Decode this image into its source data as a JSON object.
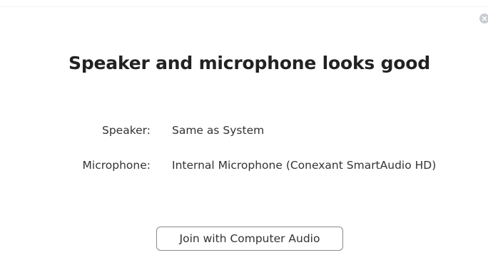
{
  "dialog": {
    "title": "Speaker and microphone looks good",
    "close_icon": "close-icon",
    "speaker": {
      "label": "Speaker:",
      "value": "Same as System"
    },
    "microphone": {
      "label": "Microphone:",
      "value": "Internal Microphone (Conexant SmartAudio HD)"
    },
    "join_button_label": "Join with Computer Audio"
  },
  "colors": {
    "title": "#222222",
    "text": "#333333",
    "close_button": "#c8ccd2",
    "button_border": "#8a8a8a"
  }
}
